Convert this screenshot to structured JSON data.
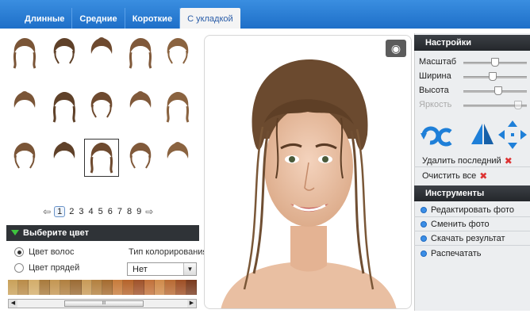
{
  "tabs": [
    {
      "label": "Длинные",
      "active": false
    },
    {
      "label": "Средние",
      "active": false
    },
    {
      "label": "Короткие",
      "active": false
    },
    {
      "label": "С укладкой",
      "active": true
    }
  ],
  "hairstyles": {
    "count": 15,
    "selected_index": 12
  },
  "pager": {
    "prev_icon": "arrow-left-icon",
    "next_icon": "arrow-right-icon",
    "pages": [
      "1",
      "2",
      "3",
      "4",
      "5",
      "6",
      "7",
      "8",
      "9"
    ],
    "current": "1"
  },
  "color_section": {
    "title": "Выберите цвет",
    "radio_hair": "Цвет волос",
    "radio_strands": "Цвет прядей",
    "selected_radio": "Цвет волос",
    "coloring_type_label": "Тип колорирования",
    "coloring_type_value": "Нет",
    "swatch_colors": [
      "#c9a15a",
      "#b98b48",
      "#d3ad6a",
      "#a87a3c",
      "#c49652",
      "#b07f3f",
      "#9b6b34",
      "#c89a57",
      "#b3803f",
      "#a56b2f",
      "#c77b3b",
      "#b5632a",
      "#a0522a",
      "#c2713a",
      "#d08a4a",
      "#b86a33",
      "#9e4f25",
      "#7a3b1e"
    ],
    "scroll_thumb_mark": "III"
  },
  "photo": {
    "view_icon": "eye-icon"
  },
  "settings": {
    "title": "Настройки",
    "sliders": [
      {
        "label": "Масштаб",
        "level": 0.5,
        "disabled": false
      },
      {
        "label": "Ширина",
        "level": 0.45,
        "disabled": false
      },
      {
        "label": "Высота",
        "level": 0.55,
        "disabled": false
      },
      {
        "label": "Яркость",
        "level": 0.92,
        "disabled": true
      }
    ],
    "tool_icons": [
      "rotate-icon",
      "flip-icon",
      "move-icon"
    ],
    "delete_last": "Удалить последний",
    "clear_all": "Очистить все"
  },
  "instruments": {
    "title": "Инструменты",
    "items": [
      "Редактировать фото",
      "Сменить фото",
      "Скачать результат",
      "Распечатать"
    ]
  },
  "colors": {
    "tabbar": "#2a7dd6",
    "panel_header": "#2d3035",
    "accent_blue": "#2b86e0",
    "close_red": "#d33333"
  }
}
